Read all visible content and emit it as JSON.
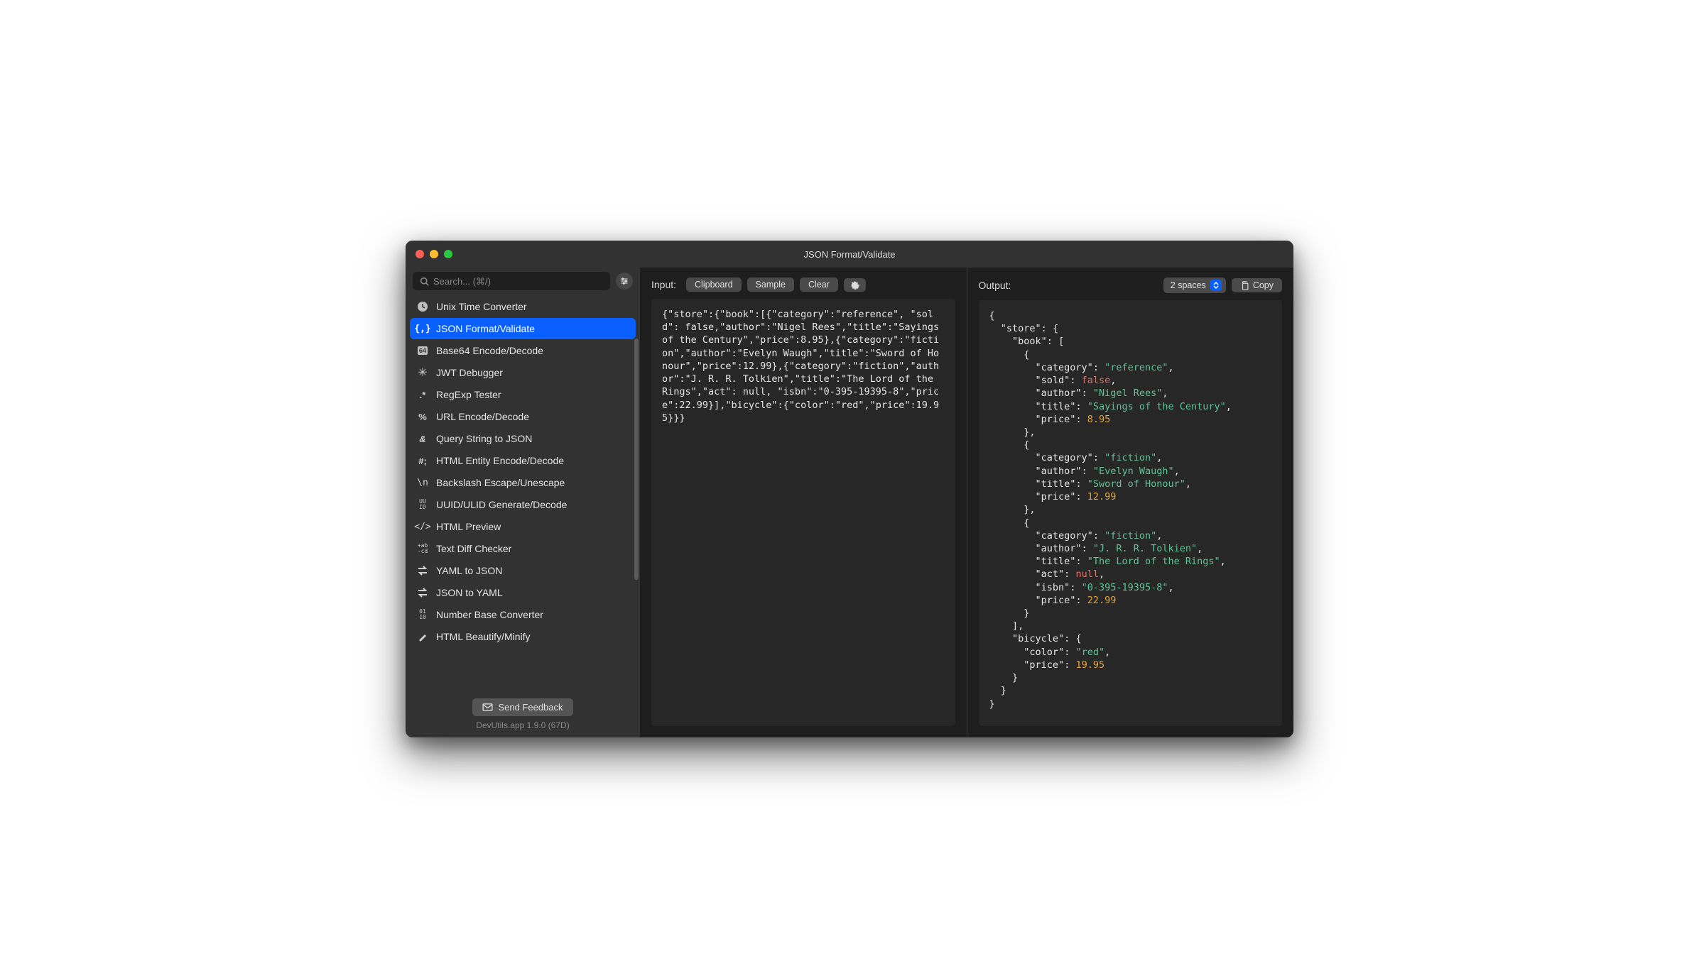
{
  "title": "JSON Format/Validate",
  "search": {
    "placeholder": "Search... (⌘/)"
  },
  "sidebar": {
    "items": [
      {
        "label": "Unix Time Converter",
        "icon": "clock-icon"
      },
      {
        "label": "JSON Format/Validate",
        "icon": "json-braces-icon",
        "active": true
      },
      {
        "label": "Base64 Encode/Decode",
        "icon": "base64-icon"
      },
      {
        "label": "JWT Debugger",
        "icon": "jwt-icon"
      },
      {
        "label": "RegExp Tester",
        "icon": "regex-icon"
      },
      {
        "label": "URL Encode/Decode",
        "icon": "percent-icon"
      },
      {
        "label": "Query String to JSON",
        "icon": "ampersand-icon"
      },
      {
        "label": "HTML Entity Encode/Decode",
        "icon": "hash-icon"
      },
      {
        "label": "Backslash Escape/Unescape",
        "icon": "backslash-icon"
      },
      {
        "label": "UUID/ULID Generate/Decode",
        "icon": "uuid-icon"
      },
      {
        "label": "HTML Preview",
        "icon": "html-tag-icon"
      },
      {
        "label": "Text Diff Checker",
        "icon": "diff-icon"
      },
      {
        "label": "YAML to JSON",
        "icon": "swap-icon"
      },
      {
        "label": "JSON to YAML",
        "icon": "swap-icon"
      },
      {
        "label": "Number Base Converter",
        "icon": "binary-icon"
      },
      {
        "label": "HTML Beautify/Minify",
        "icon": "wand-icon"
      }
    ],
    "feedback": "Send Feedback",
    "version": "DevUtils.app 1.9.0 (67D)"
  },
  "input": {
    "label": "Input:",
    "buttons": {
      "clipboard": "Clipboard",
      "sample": "Sample",
      "clear": "Clear"
    },
    "text": "{\"store\":{\"book\":[{\"category\":\"reference\", \"sold\": false,\"author\":\"Nigel Rees\",\"title\":\"Sayings of the Century\",\"price\":8.95},{\"category\":\"fiction\",\"author\":\"Evelyn Waugh\",\"title\":\"Sword of Honour\",\"price\":12.99},{\"category\":\"fiction\",\"author\":\"J. R. R. Tolkien\",\"title\":\"The Lord of the Rings\",\"act\": null, \"isbn\":\"0-395-19395-8\",\"price\":22.99}],\"bicycle\":{\"color\":\"red\",\"price\":19.95}}}"
  },
  "output": {
    "label": "Output:",
    "indent": "2 spaces",
    "copy": "Copy",
    "json": {
      "store": {
        "book": [
          {
            "category": "reference",
            "sold": false,
            "author": "Nigel Rees",
            "title": "Sayings of the Century",
            "price": 8.95
          },
          {
            "category": "fiction",
            "author": "Evelyn Waugh",
            "title": "Sword of Honour",
            "price": 12.99
          },
          {
            "category": "fiction",
            "author": "J. R. R. Tolkien",
            "title": "The Lord of the Rings",
            "act": null,
            "isbn": "0-395-19395-8",
            "price": 22.99
          }
        ],
        "bicycle": {
          "color": "red",
          "price": 19.95
        }
      }
    }
  }
}
